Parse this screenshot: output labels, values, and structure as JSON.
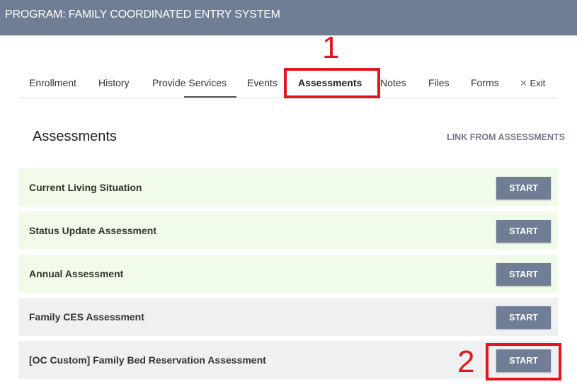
{
  "header": {
    "title": "PROGRAM: FAMILY COORDINATED ENTRY SYSTEM"
  },
  "tabs": [
    {
      "label": "Enrollment"
    },
    {
      "label": "History"
    },
    {
      "label": "Provide Services"
    },
    {
      "label": "Events"
    },
    {
      "label": "Assessments",
      "active": true
    },
    {
      "label": "Notes"
    },
    {
      "label": "Files"
    },
    {
      "label": "Forms"
    },
    {
      "label": "Exit",
      "icon": "close-icon"
    }
  ],
  "exit_icon": "✕",
  "annotations": {
    "one": "1",
    "two": "2",
    "color": "#e3141e"
  },
  "section": {
    "title": "Assessments",
    "link": "LINK FROM ASSESSMENTS"
  },
  "assessments": [
    {
      "name": "Current Living Situation",
      "button": "START",
      "bg": "#f1fbe9"
    },
    {
      "name": "Status Update Assessment",
      "button": "START",
      "bg": "#f1fbe9"
    },
    {
      "name": "Annual Assessment",
      "button": "START",
      "bg": "#f1fbe9"
    },
    {
      "name": "Family CES Assessment",
      "button": "START",
      "bg": "#eff0f2"
    },
    {
      "name": "[OC Custom] Family Bed Reservation Assessment",
      "button": "START",
      "bg": "#eff0f2"
    }
  ]
}
